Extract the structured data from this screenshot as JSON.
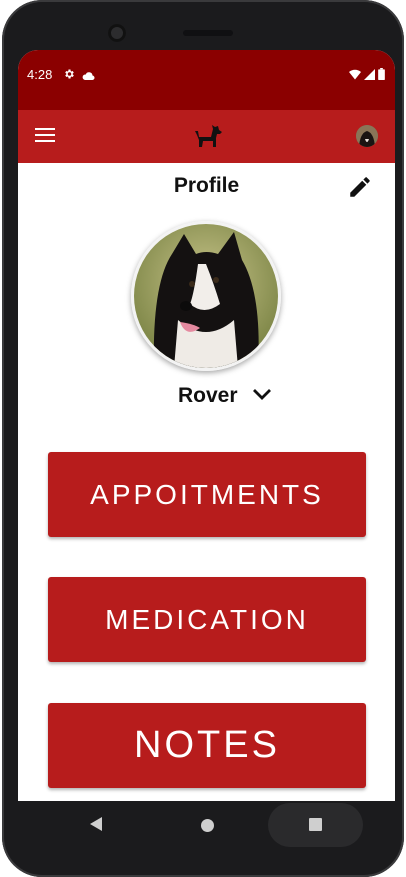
{
  "status_bar": {
    "time": "4:28",
    "icons": [
      "gear-icon",
      "cloud-icon",
      "wifi-icon",
      "signal-icon",
      "battery-icon"
    ]
  },
  "app_bar": {
    "menu_icon": "menu-icon",
    "logo_icon": "dog-logo-icon",
    "avatar": "user-avatar"
  },
  "profile": {
    "title": "Profile",
    "edit_icon": "pencil-icon",
    "pet_name": "Rover",
    "dropdown_icon": "chevron-down-icon"
  },
  "buttons": {
    "appointments": "APPOITMENTS",
    "medication": "MEDICATION",
    "notes": "NOTES"
  },
  "nav": {
    "back": "back-icon",
    "home": "home-icon",
    "recents": "recents-icon"
  },
  "colors": {
    "status_bar": "#8b0000",
    "app_bar": "#b71c1c",
    "button": "#b71c1c"
  }
}
